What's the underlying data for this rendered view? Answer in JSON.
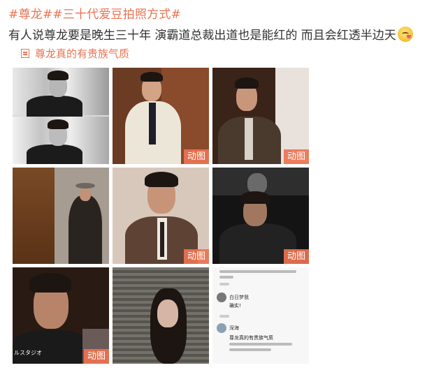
{
  "post": {
    "hashtags": [
      "#尊龙#",
      "#三十代爱豆拍照方式#"
    ],
    "text": "有人说尊龙要是晚生三十年 演霸道总裁出道也是能红的 而且会红透半边天",
    "emoji": "smirk-emoji",
    "link_label": "尊龙真的有贵族气质"
  },
  "images": [
    {
      "badge": ""
    },
    {
      "badge": "动图"
    },
    {
      "badge": "动图"
    },
    {
      "badge": ""
    },
    {
      "badge": "动图"
    },
    {
      "badge": "动图"
    },
    {
      "badge": "动图",
      "caption": "ルスタジオ"
    },
    {
      "badge": ""
    },
    {
      "badge": ""
    }
  ],
  "comment_screenshot": {
    "comments": [
      {
        "user": "白日梦我",
        "text": "确实!"
      },
      {
        "user": "深海",
        "text": "尊龙真的有贵族气质"
      }
    ]
  },
  "colors": {
    "accent": "#eb7350",
    "text": "#333333"
  }
}
